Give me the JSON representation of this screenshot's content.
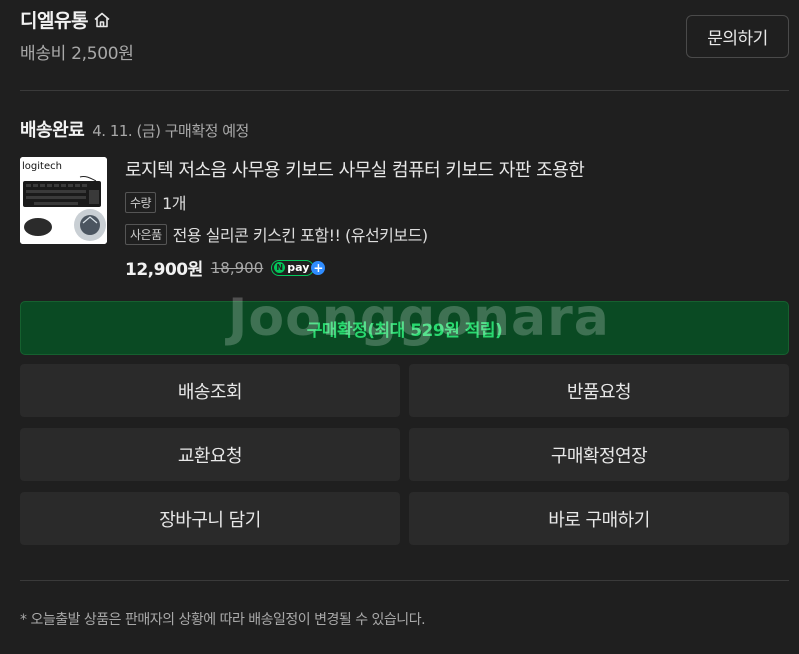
{
  "store": {
    "name": "디엘유통",
    "shipping_fee": "배송비 2,500원",
    "inquiry_label": "문의하기"
  },
  "order": {
    "status": "배송완료",
    "status_detail": "4. 11. (금) 구매확정 예정"
  },
  "product": {
    "thumb_brand": "logitech",
    "title": "로지텍 저소음 사무용 키보드 사무실 컴퓨터 키보드 자판 조용한",
    "quantity_tag": "수량",
    "quantity_value": "1개",
    "gift_tag": "사은품",
    "gift_value": "전용 실리콘 키스킨 포함!! (유선키보드)",
    "price": "12,900원",
    "original_price": "18,900",
    "npay_n": "N",
    "npay_text": "pay",
    "npay_plus": "+"
  },
  "actions": {
    "confirm_label": "구매확정(최대 529원 적립)",
    "track_label": "배송조회",
    "return_label": "반품요청",
    "exchange_label": "교환요청",
    "extend_label": "구매확정연장",
    "cart_label": "장바구니 담기",
    "buy_now_label": "바로 구매하기"
  },
  "watermark": "Joonggonara",
  "footer_note": "* 오늘출발 상품은 판매자의 상황에 따라 배송일정이 변경될 수 있습니다.",
  "colors": {
    "background": "#1f1f1f",
    "confirm_bg": "#0a4a23",
    "confirm_text": "#29d96f",
    "npay_green": "#03c75a",
    "npay_plus": "#2f8cff"
  },
  "icons": {
    "store": "home-icon"
  }
}
